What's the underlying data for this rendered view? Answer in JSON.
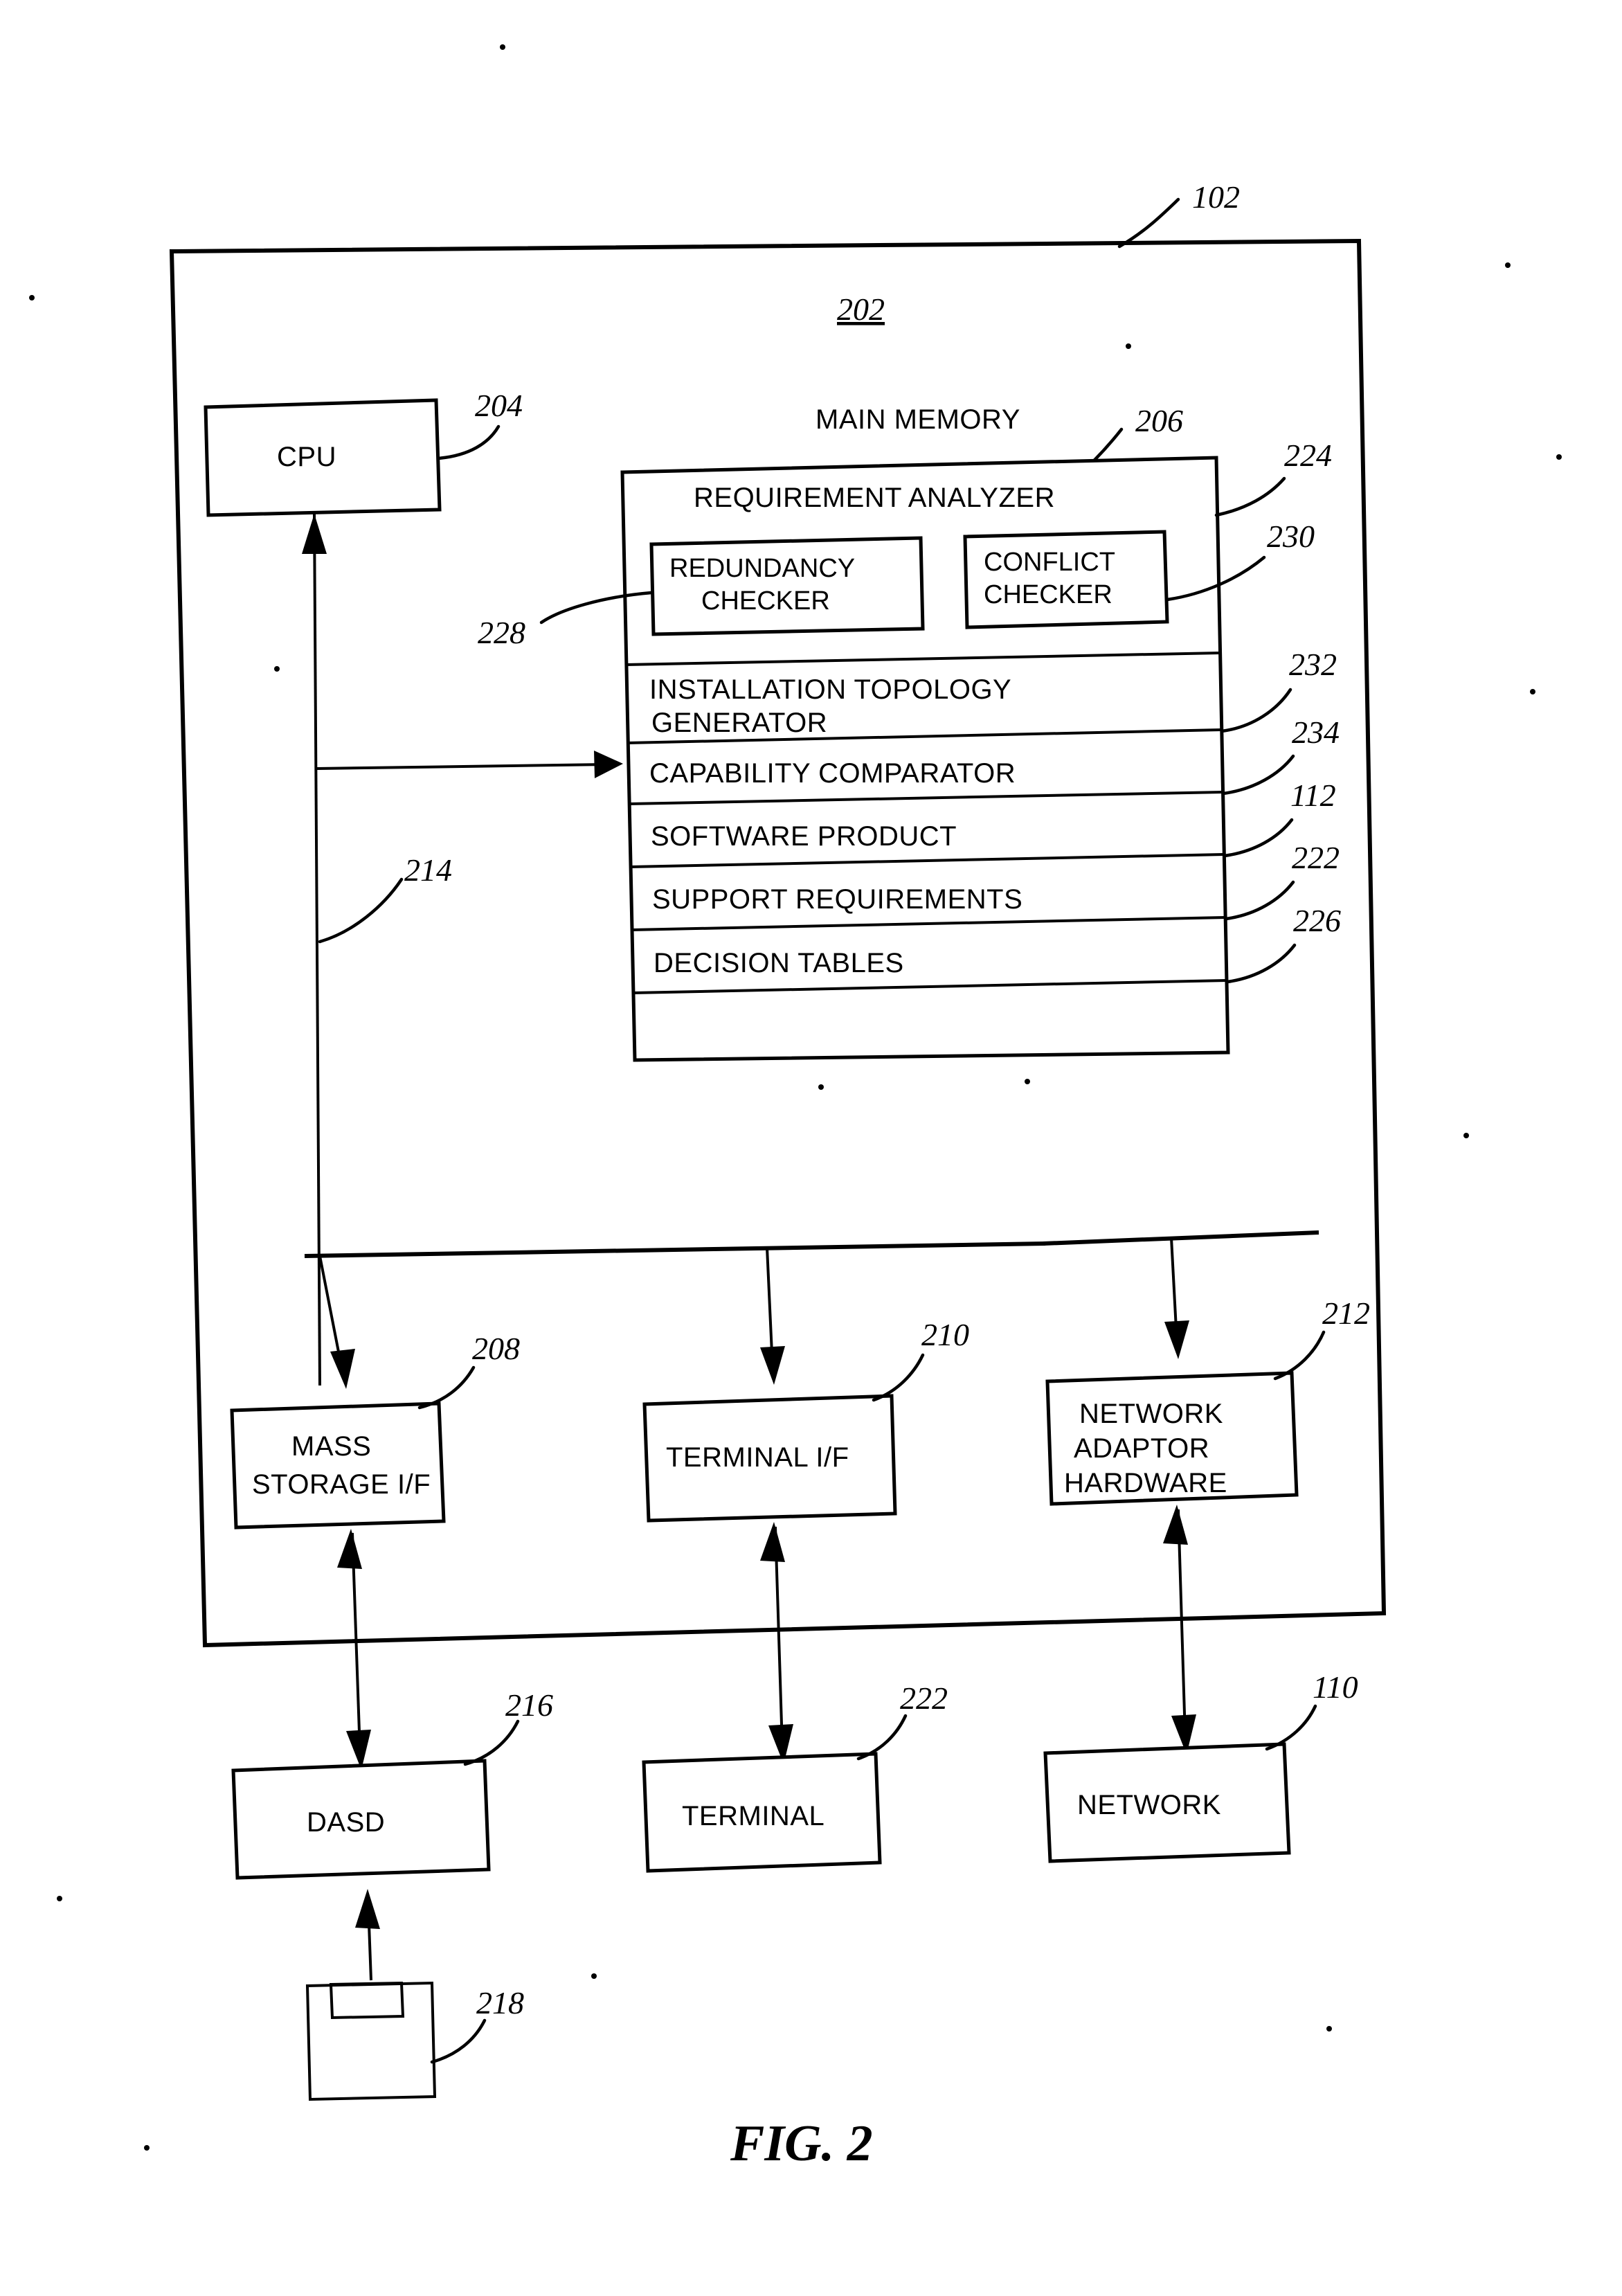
{
  "figure": {
    "caption": "FIG. 2",
    "system_ref": "102",
    "computer_system_ref": "202"
  },
  "cpu": {
    "label": "CPU",
    "ref": "204"
  },
  "bus": {
    "ref": "214"
  },
  "main_memory": {
    "title": "MAIN MEMORY",
    "ref": "206",
    "requirement_analyzer": {
      "label": "REQUIREMENT ANALYZER",
      "ref": "224",
      "children": [
        {
          "label_line1": "REDUNDANCY",
          "label_line2": "CHECKER",
          "ref": "228"
        },
        {
          "label_line1": "CONFLICT",
          "label_line2": "CHECKER",
          "ref": "230"
        }
      ]
    },
    "rows": [
      {
        "label_line1": "INSTALLATION TOPOLOGY",
        "label_line2": "GENERATOR",
        "ref": "232"
      },
      {
        "label_line1": "CAPABILITY COMPARATOR",
        "label_line2": "",
        "ref": "234"
      },
      {
        "label_line1": "SOFTWARE PRODUCT",
        "label_line2": "",
        "ref": "112"
      },
      {
        "label_line1": "SUPPORT REQUIREMENTS",
        "label_line2": "",
        "ref": "222"
      },
      {
        "label_line1": "DECISION TABLES",
        "label_line2": "",
        "ref": "226"
      }
    ]
  },
  "interfaces": [
    {
      "line1": "MASS",
      "line2": "STORAGE I/F",
      "line3": "",
      "ref": "208"
    },
    {
      "line1": "TERMINAL I/F",
      "line2": "",
      "line3": "",
      "ref": "210"
    },
    {
      "line1": "NETWORK",
      "line2": "ADAPTOR",
      "line3": "HARDWARE",
      "ref": "212"
    }
  ],
  "peripherals": [
    {
      "label": "DASD",
      "ref": "216"
    },
    {
      "label": "TERMINAL",
      "ref": "222"
    },
    {
      "label": "NETWORK",
      "ref": "110"
    }
  ],
  "removable_media": {
    "icon": "floppy-disk-icon",
    "ref": "218"
  }
}
